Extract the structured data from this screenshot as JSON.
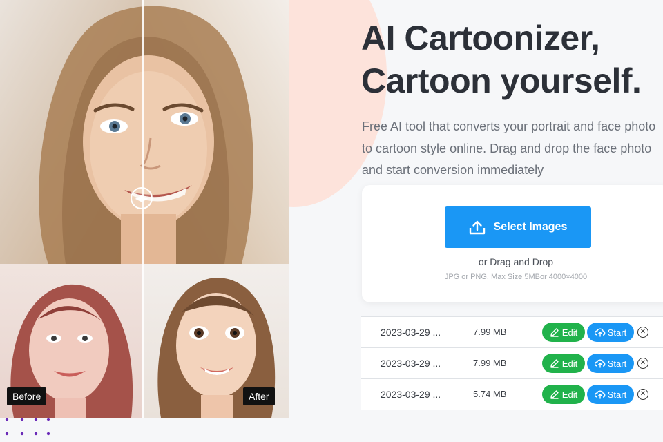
{
  "hero": {
    "title_line1": "AI Cartoonizer,",
    "title_line2": "Cartoon yourself.",
    "description": "Free AI tool that converts your portrait and face photo to cartoon style online. Drag and drop the face photo and start conversion immediately"
  },
  "upload": {
    "button_label": "Select Images",
    "drag_text": "or Drag and Drop",
    "size_hint": "JPG or PNG. Max Size 5MBor 4000×4000"
  },
  "comparison": {
    "before_label": "Before",
    "after_label": "After"
  },
  "files": [
    {
      "name": "2023-03-29 ...",
      "size": "7.99 MB",
      "edit_label": "Edit",
      "start_label": "Start"
    },
    {
      "name": "2023-03-29 ...",
      "size": "7.99 MB",
      "edit_label": "Edit",
      "start_label": "Start"
    },
    {
      "name": "2023-03-29 ...",
      "size": "5.74 MB",
      "edit_label": "Edit",
      "start_label": "Start"
    }
  ],
  "colors": {
    "primary_blue": "#1a97f5",
    "edit_green": "#21b24b",
    "title_dark": "#2c3038",
    "peach_blob": "#fde3db"
  },
  "icons": {
    "upload": "upload-icon",
    "edit": "pencil-icon",
    "start": "cloud-upload-icon",
    "remove": "close-circle-icon",
    "handle": "slider-arrows-icon"
  }
}
